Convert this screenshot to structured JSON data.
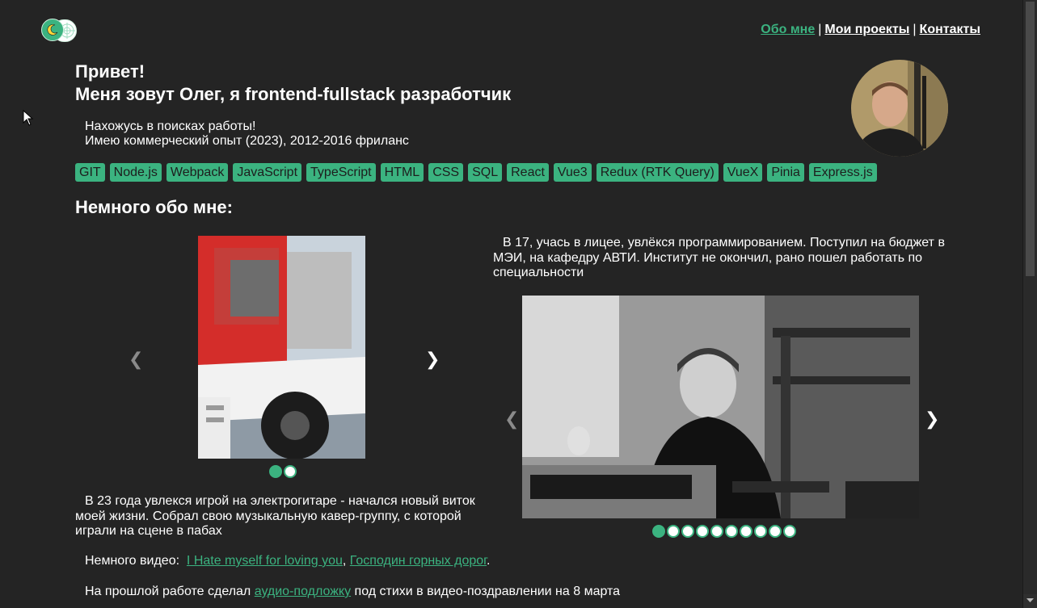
{
  "nav": {
    "items": [
      {
        "label": "Обо мне",
        "active": true
      },
      {
        "label": "Мои проекты",
        "active": false
      },
      {
        "label": "Контакты",
        "active": false
      }
    ],
    "separator": "|"
  },
  "hero": {
    "greeting_line1": "Привет!",
    "greeting_line2": "Меня зовут Олег, я frontend-fullstack разработчик",
    "intro_line1": "Нахожусь в поисках работы!",
    "intro_line2": "Имею коммерческий опыт (2023), 2012-2016 фриланс"
  },
  "tags": [
    "GIT",
    "Node.js",
    "Webpack",
    "JavaScript",
    "TypeScript",
    "HTML",
    "CSS",
    "SQL",
    "React",
    "Vue3",
    "Redux (RTK Query)",
    "VueX",
    "Pinia",
    "Express.js"
  ],
  "about": {
    "title": "Немного обо мне:",
    "text_right": "В 17, учась в лицее, увлёкся программированием. Поступил на бюджет в МЭИ, на кафедру АВТИ. Институт не окончил, рано пошел работать по специальности",
    "text_left": "В 23 года увлекся игрой на электрогитаре - начался новый виток моей жизни. Собрал свою музыкальную кавер-группу, с которой играли на сцене в пабах",
    "video_label": "Немного видео:",
    "video_link1": "I Hate myself for loving you",
    "video_sep": ",",
    "video_link2": "Господин горных дорог",
    "video_end": ".",
    "work_prefix": "На прошлой работе сделал",
    "work_link": "аудио-подложку",
    "work_suffix": "под стихи в видео-поздравлении на 8 марта"
  },
  "carousel1": {
    "prev": "❮",
    "next": "❯",
    "slides": 2,
    "active": 0
  },
  "carousel2": {
    "prev": "❮",
    "next": "❯",
    "slides": 10,
    "active": 0
  },
  "colors": {
    "accent": "#3bb380",
    "background": "#242424",
    "text": "#ffffff"
  }
}
